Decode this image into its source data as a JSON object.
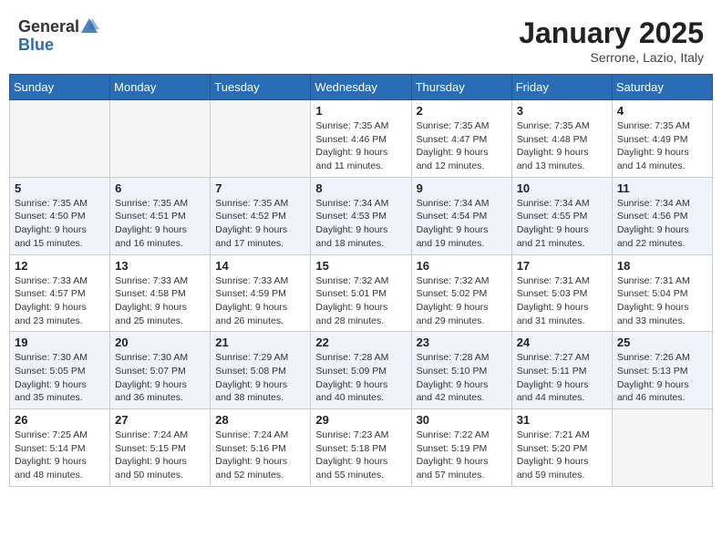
{
  "logo": {
    "general": "General",
    "blue": "Blue"
  },
  "header": {
    "month": "January 2025",
    "location": "Serrone, Lazio, Italy"
  },
  "weekdays": [
    "Sunday",
    "Monday",
    "Tuesday",
    "Wednesday",
    "Thursday",
    "Friday",
    "Saturday"
  ],
  "weeks": [
    [
      {
        "day": "",
        "info": ""
      },
      {
        "day": "",
        "info": ""
      },
      {
        "day": "",
        "info": ""
      },
      {
        "day": "1",
        "info": "Sunrise: 7:35 AM\nSunset: 4:46 PM\nDaylight: 9 hours and 11 minutes."
      },
      {
        "day": "2",
        "info": "Sunrise: 7:35 AM\nSunset: 4:47 PM\nDaylight: 9 hours and 12 minutes."
      },
      {
        "day": "3",
        "info": "Sunrise: 7:35 AM\nSunset: 4:48 PM\nDaylight: 9 hours and 13 minutes."
      },
      {
        "day": "4",
        "info": "Sunrise: 7:35 AM\nSunset: 4:49 PM\nDaylight: 9 hours and 14 minutes."
      }
    ],
    [
      {
        "day": "5",
        "info": "Sunrise: 7:35 AM\nSunset: 4:50 PM\nDaylight: 9 hours and 15 minutes."
      },
      {
        "day": "6",
        "info": "Sunrise: 7:35 AM\nSunset: 4:51 PM\nDaylight: 9 hours and 16 minutes."
      },
      {
        "day": "7",
        "info": "Sunrise: 7:35 AM\nSunset: 4:52 PM\nDaylight: 9 hours and 17 minutes."
      },
      {
        "day": "8",
        "info": "Sunrise: 7:34 AM\nSunset: 4:53 PM\nDaylight: 9 hours and 18 minutes."
      },
      {
        "day": "9",
        "info": "Sunrise: 7:34 AM\nSunset: 4:54 PM\nDaylight: 9 hours and 19 minutes."
      },
      {
        "day": "10",
        "info": "Sunrise: 7:34 AM\nSunset: 4:55 PM\nDaylight: 9 hours and 21 minutes."
      },
      {
        "day": "11",
        "info": "Sunrise: 7:34 AM\nSunset: 4:56 PM\nDaylight: 9 hours and 22 minutes."
      }
    ],
    [
      {
        "day": "12",
        "info": "Sunrise: 7:33 AM\nSunset: 4:57 PM\nDaylight: 9 hours and 23 minutes."
      },
      {
        "day": "13",
        "info": "Sunrise: 7:33 AM\nSunset: 4:58 PM\nDaylight: 9 hours and 25 minutes."
      },
      {
        "day": "14",
        "info": "Sunrise: 7:33 AM\nSunset: 4:59 PM\nDaylight: 9 hours and 26 minutes."
      },
      {
        "day": "15",
        "info": "Sunrise: 7:32 AM\nSunset: 5:01 PM\nDaylight: 9 hours and 28 minutes."
      },
      {
        "day": "16",
        "info": "Sunrise: 7:32 AM\nSunset: 5:02 PM\nDaylight: 9 hours and 29 minutes."
      },
      {
        "day": "17",
        "info": "Sunrise: 7:31 AM\nSunset: 5:03 PM\nDaylight: 9 hours and 31 minutes."
      },
      {
        "day": "18",
        "info": "Sunrise: 7:31 AM\nSunset: 5:04 PM\nDaylight: 9 hours and 33 minutes."
      }
    ],
    [
      {
        "day": "19",
        "info": "Sunrise: 7:30 AM\nSunset: 5:05 PM\nDaylight: 9 hours and 35 minutes."
      },
      {
        "day": "20",
        "info": "Sunrise: 7:30 AM\nSunset: 5:07 PM\nDaylight: 9 hours and 36 minutes."
      },
      {
        "day": "21",
        "info": "Sunrise: 7:29 AM\nSunset: 5:08 PM\nDaylight: 9 hours and 38 minutes."
      },
      {
        "day": "22",
        "info": "Sunrise: 7:28 AM\nSunset: 5:09 PM\nDaylight: 9 hours and 40 minutes."
      },
      {
        "day": "23",
        "info": "Sunrise: 7:28 AM\nSunset: 5:10 PM\nDaylight: 9 hours and 42 minutes."
      },
      {
        "day": "24",
        "info": "Sunrise: 7:27 AM\nSunset: 5:11 PM\nDaylight: 9 hours and 44 minutes."
      },
      {
        "day": "25",
        "info": "Sunrise: 7:26 AM\nSunset: 5:13 PM\nDaylight: 9 hours and 46 minutes."
      }
    ],
    [
      {
        "day": "26",
        "info": "Sunrise: 7:25 AM\nSunset: 5:14 PM\nDaylight: 9 hours and 48 minutes."
      },
      {
        "day": "27",
        "info": "Sunrise: 7:24 AM\nSunset: 5:15 PM\nDaylight: 9 hours and 50 minutes."
      },
      {
        "day": "28",
        "info": "Sunrise: 7:24 AM\nSunset: 5:16 PM\nDaylight: 9 hours and 52 minutes."
      },
      {
        "day": "29",
        "info": "Sunrise: 7:23 AM\nSunset: 5:18 PM\nDaylight: 9 hours and 55 minutes."
      },
      {
        "day": "30",
        "info": "Sunrise: 7:22 AM\nSunset: 5:19 PM\nDaylight: 9 hours and 57 minutes."
      },
      {
        "day": "31",
        "info": "Sunrise: 7:21 AM\nSunset: 5:20 PM\nDaylight: 9 hours and 59 minutes."
      },
      {
        "day": "",
        "info": ""
      }
    ]
  ]
}
